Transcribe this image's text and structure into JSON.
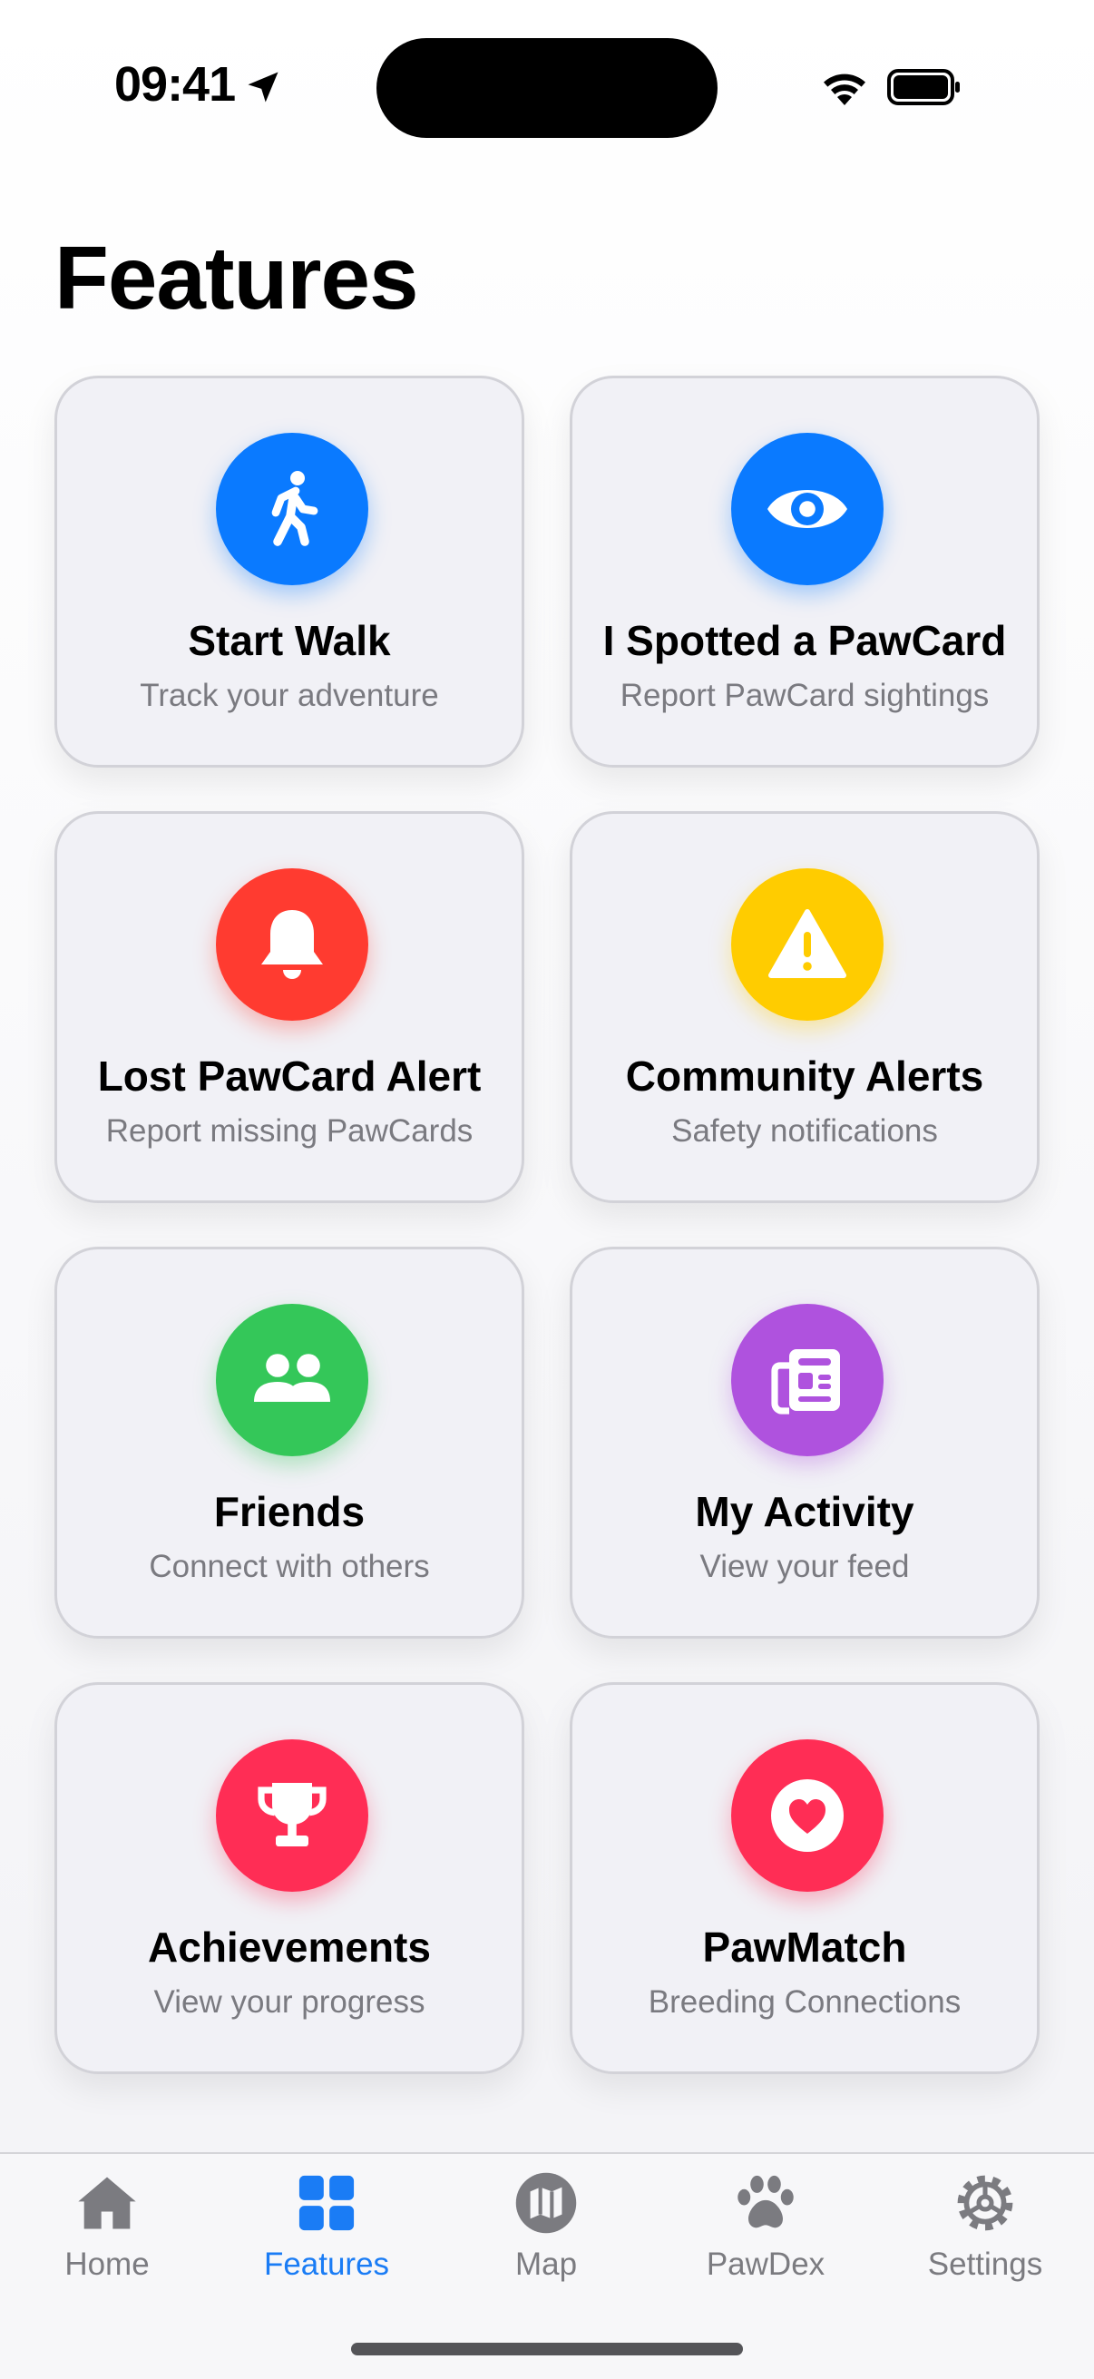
{
  "status_bar": {
    "time": "09:41"
  },
  "page": {
    "title": "Features"
  },
  "cards": [
    {
      "title": "Start Walk",
      "subtitle": "Track your adventure",
      "icon": "walk-icon",
      "color": "#0a7aff"
    },
    {
      "title": "I Spotted a PawCard",
      "subtitle": "Report PawCard sightings",
      "icon": "eye-icon",
      "color": "#0a7aff"
    },
    {
      "title": "Lost PawCard Alert",
      "subtitle": "Report missing PawCards",
      "icon": "bell-icon",
      "color": "#ff3b30"
    },
    {
      "title": "Community Alerts",
      "subtitle": "Safety notifications",
      "icon": "warning-icon",
      "color": "#ffcc00"
    },
    {
      "title": "Friends",
      "subtitle": "Connect with others",
      "icon": "friends-icon",
      "color": "#34c759"
    },
    {
      "title": "My Activity",
      "subtitle": "View your feed",
      "icon": "newspaper-icon",
      "color": "#af52de"
    },
    {
      "title": "Achievements",
      "subtitle": "View your progress",
      "icon": "trophy-icon",
      "color": "#ff2d55"
    },
    {
      "title": "PawMatch",
      "subtitle": "Breeding Connections",
      "icon": "heart-icon",
      "color": "#ff2d55"
    }
  ],
  "tabs": [
    {
      "label": "Home",
      "icon": "house-icon"
    },
    {
      "label": "Features",
      "icon": "grid-icon",
      "active": true
    },
    {
      "label": "Map",
      "icon": "map-icon"
    },
    {
      "label": "PawDex",
      "icon": "paw-icon"
    },
    {
      "label": "Settings",
      "icon": "gear-icon"
    }
  ],
  "colors": {
    "accent": "#1a7cf5",
    "inactive": "#7b7b80"
  }
}
